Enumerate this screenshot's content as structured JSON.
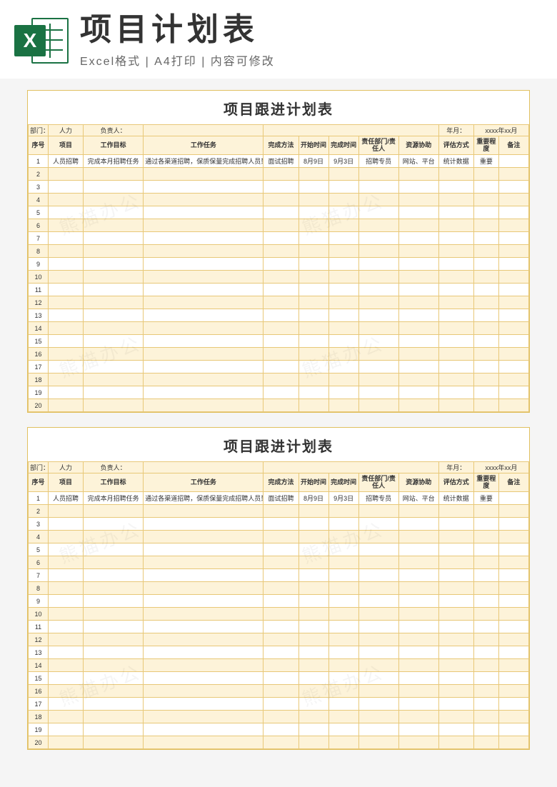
{
  "banner": {
    "excel_letter": "X",
    "title": "项目计划表",
    "subtitle": "Excel格式 | A4打印 | 内容可修改"
  },
  "sheet": {
    "title": "项目跟进计划表",
    "meta": {
      "dept_label": "部门：",
      "dept_value": "人力",
      "owner_label": "负责人：",
      "owner_value": "",
      "ym_label": "年月：",
      "ym_value": "xxxx年xx月"
    },
    "columns": [
      "序号",
      "项目",
      "工作目标",
      "工作任务",
      "完成方法",
      "开始时间",
      "完成时间",
      "责任部门/责任人",
      "资源协助",
      "评估方式",
      "重要程度",
      "备注"
    ],
    "row1": {
      "seq": "1",
      "proj": "人员招聘",
      "goal": "完成本月招聘任务",
      "task": "通过各渠道招聘，保质保量完成招聘人员到岗。",
      "meth": "面试招聘",
      "start": "8月9日",
      "end": "9月3日",
      "resp": "招聘专员",
      "res": "网站、平台",
      "eval": "统计数据",
      "imp": "重要",
      "note": ""
    },
    "row_count": 20
  },
  "watermark": "熊猫办公"
}
